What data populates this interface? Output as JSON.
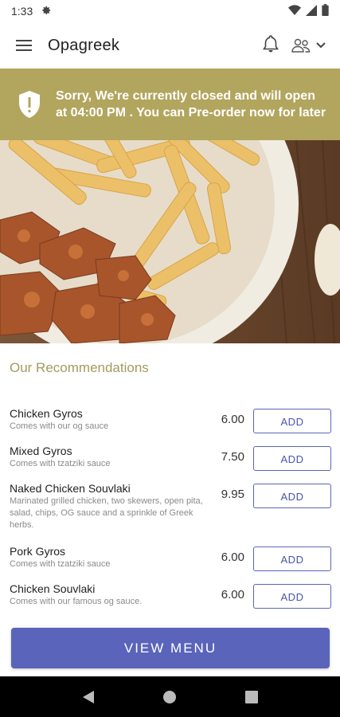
{
  "status": {
    "time": "1:33"
  },
  "app": {
    "title": "Opagreek"
  },
  "banner": {
    "message": "Sorry, We're currently closed and will open at 04:00 PM . You can Pre-order now for later"
  },
  "recommendations": {
    "title": "Our Recommendations",
    "items": [
      {
        "name": "Chicken Gyros",
        "desc": "Comes with our og sauce",
        "price": "6.00",
        "action": "ADD"
      },
      {
        "name": "Mixed Gyros",
        "desc": "Comes with tzatziki sauce",
        "price": "7.50",
        "action": "ADD"
      },
      {
        "name": "Naked Chicken Souvlaki",
        "desc": "Marinated grilled chicken, two skewers, open pita, salad, chips, OG sauce and a sprinkle of Greek herbs.",
        "price": "9.95",
        "action": "ADD"
      },
      {
        "name": "Pork Gyros",
        "desc": "Comes with tzatziki sauce",
        "price": "6.00",
        "action": "ADD"
      },
      {
        "name": "Chicken Souvlaki",
        "desc": "Comes with our famous og sauce.",
        "price": "6.00",
        "action": "ADD"
      }
    ]
  },
  "cta": {
    "view_menu": "VIEW MENU"
  },
  "colors": {
    "banner": "#b2a55e",
    "accent": "#5a64ba",
    "section_title": "#a59a5f"
  },
  "icons": {
    "status": [
      "gear-icon",
      "wifi-icon",
      "signal-icon",
      "battery-icon"
    ],
    "app_bar": [
      "hamburger-menu-icon",
      "bell-icon",
      "people-icon",
      "chevron-down-icon"
    ],
    "banner": "shield-alert-icon",
    "nav": [
      "back-icon",
      "home-icon",
      "recents-icon"
    ]
  }
}
